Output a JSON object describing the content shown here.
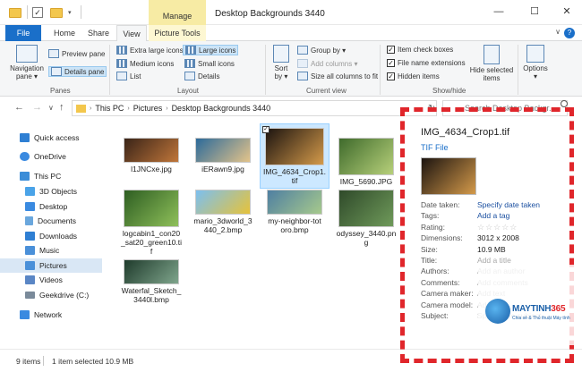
{
  "window": {
    "title": "Desktop Backgrounds 3440",
    "manage_tab": "Manage",
    "min": "—",
    "max": "☐",
    "close": "✕"
  },
  "tabs": {
    "file": "File",
    "home": "Home",
    "share": "Share",
    "view": "View",
    "picture_tools": "Picture Tools",
    "help": "?",
    "chevron": "∨"
  },
  "ribbon": {
    "panes": {
      "navigation_pane_l1": "Navigation",
      "navigation_pane_l2": "pane ▾",
      "preview_pane": "Preview pane",
      "details_pane": "Details pane",
      "label": "Panes"
    },
    "layout": {
      "extra_large": "Extra large icons",
      "large": "Large icons",
      "medium": "Medium icons",
      "small": "Small icons",
      "list": "List",
      "details": "Details",
      "label": "Layout"
    },
    "current_view": {
      "sort_by_l1": "Sort",
      "sort_by_l2": "by ▾",
      "group_by": "Group by ▾",
      "add_columns": "Add columns ▾",
      "size_columns": "Size all columns to fit",
      "label": "Current view"
    },
    "show_hide": {
      "item_checkboxes": "Item check boxes",
      "file_name_extensions": "File name extensions",
      "hidden_items": "Hidden items",
      "hide_selected_l1": "Hide selected",
      "hide_selected_l2": "items",
      "label": "Show/hide"
    },
    "options": {
      "label_l1": "Options",
      "label_l2": "▾"
    }
  },
  "address": {
    "back": "←",
    "forward": "→",
    "recent": "∨",
    "up": "↑",
    "crumbs": [
      "This PC",
      "Pictures",
      "Desktop Backgrounds 3440"
    ],
    "dropdown": "∨",
    "refresh": "↻",
    "search_placeholder": "Search Desktop Backgr..."
  },
  "nav": {
    "items": [
      {
        "label": "Quick access",
        "icon": "star-icon",
        "color": "#2f7fd3"
      },
      {
        "label": "OneDrive",
        "icon": "cloud-icon",
        "color": "#3a8ae0"
      },
      {
        "label": "This PC",
        "icon": "computer-icon",
        "color": "#3b8dd8"
      },
      {
        "label": "3D Objects",
        "icon": "cube-icon",
        "color": "#4aa3e8"
      },
      {
        "label": "Desktop",
        "icon": "desktop-icon",
        "color": "#3a8ae0"
      },
      {
        "label": "Documents",
        "icon": "document-icon",
        "color": "#6aa7dd"
      },
      {
        "label": "Downloads",
        "icon": "download-icon",
        "color": "#2f7fd3"
      },
      {
        "label": "Music",
        "icon": "music-icon",
        "color": "#4a90d9"
      },
      {
        "label": "Pictures",
        "icon": "picture-icon",
        "color": "#4a90d9"
      },
      {
        "label": "Videos",
        "icon": "video-icon",
        "color": "#5a86c5"
      },
      {
        "label": "Geekdrive (C:)",
        "icon": "drive-icon",
        "color": "#7a8a9a"
      },
      {
        "label": "Network",
        "icon": "network-icon",
        "color": "#3a8ae0"
      }
    ]
  },
  "files": [
    {
      "name": "l1JNCxe.jpg",
      "colors": [
        "#3a2418",
        "#c0763a"
      ]
    },
    {
      "name": "iERawn9.jpg",
      "colors": [
        "#2c6a9a",
        "#e3c38a"
      ]
    },
    {
      "name": "IMG_4634_Crop1.tif",
      "colors": [
        "#1c1410",
        "#d49a4a"
      ]
    },
    {
      "name": "IMG_5690.JPG",
      "colors": [
        "#3f6b2c",
        "#b7d07a"
      ]
    },
    {
      "name": "logcabin1_con20_sat20_green10.tif",
      "colors": [
        "#2e5e22",
        "#8fc05a"
      ]
    },
    {
      "name": "mario_3dworld_3440_2.bmp",
      "colors": [
        "#7cc0f0",
        "#e6c23a"
      ]
    },
    {
      "name": "my-neighbor-totoro.bmp",
      "colors": [
        "#4f7fa2",
        "#a6c98c"
      ]
    },
    {
      "name": "odyssey_3440.png",
      "colors": [
        "#2f4a2a",
        "#6f9a5a"
      ]
    },
    {
      "name": "Waterfal_Sketch_3440l.bmp",
      "colors": [
        "#1f3b2c",
        "#7fa58c"
      ]
    }
  ],
  "file_labels": [
    [
      "l1JNCxe.jpg"
    ],
    [
      "iERawn9.jpg"
    ],
    [
      "IMG_4634_Crop1.",
      "tif"
    ],
    [
      "IMG_5690.JPG"
    ],
    [
      "logcabin1_con20",
      "_sat20_green10.ti",
      "f"
    ],
    [
      "mario_3dworld_3",
      "440_2.bmp"
    ],
    [
      "my-neighbor-tot",
      "oro.bmp"
    ],
    [
      "odyssey_3440.pn",
      "g"
    ],
    [
      "Waterfal_Sketch_",
      "3440l.bmp"
    ]
  ],
  "details": {
    "name": "IMG_4634_Crop1.tif",
    "type": "TIF File",
    "rows": [
      {
        "key": "Date taken:",
        "value": "Specify date taken",
        "style": "link"
      },
      {
        "key": "Tags:",
        "value": "Add a tag",
        "style": "link"
      },
      {
        "key": "Rating:",
        "value": "☆☆☆☆☆",
        "style": "stars"
      },
      {
        "key": "Dimensions:",
        "value": "3012 x 2008",
        "style": "plain"
      },
      {
        "key": "Size:",
        "value": "10.9 MB",
        "style": "plain"
      },
      {
        "key": "Title:",
        "value": "Add a title",
        "style": "muted"
      },
      {
        "key": "Authors:",
        "value": "Add an author",
        "style": "muted"
      },
      {
        "key": "Comments:",
        "value": "Add comments",
        "style": "muted"
      },
      {
        "key": "Camera maker:",
        "value": "Add text",
        "style": "muted"
      },
      {
        "key": "Camera model:",
        "value": "Add text",
        "style": "muted"
      },
      {
        "key": "Subject:",
        "value": "Specify the subject",
        "style": "muted"
      }
    ]
  },
  "status": {
    "count": "9 items",
    "selected": "1 item selected  10.9 MB"
  },
  "watermark": {
    "brand": "MAYTINH",
    "num": "365",
    "tagline": "Chia sẻ & Thủ thuật Máy tính"
  },
  "colors": {
    "accent": "#1a6fc9",
    "annotation": "#e0262b",
    "selection": "#cce8ff"
  }
}
